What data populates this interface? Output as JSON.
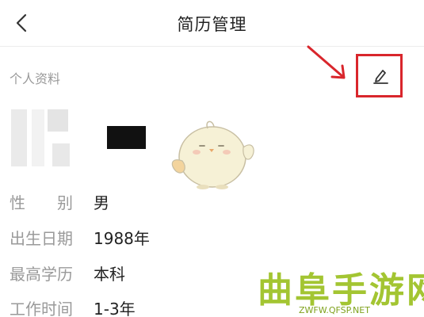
{
  "header": {
    "title": "简历管理",
    "back_icon": "chevron-left-icon"
  },
  "profile": {
    "section_title": "个人资料",
    "edit_icon": "pencil-edit-icon",
    "highlight_color": "#d9262c"
  },
  "info": [
    {
      "label": "性　　别",
      "value": "男"
    },
    {
      "label": "出生日期",
      "value": "1988年"
    },
    {
      "label": "最高学历",
      "value": "本科"
    },
    {
      "label": "工作时间",
      "value": "1-3年"
    }
  ],
  "watermark": {
    "title": "曲阜手游网",
    "url": "ZWFW.QFSP.NET",
    "color": "#a3c532"
  }
}
